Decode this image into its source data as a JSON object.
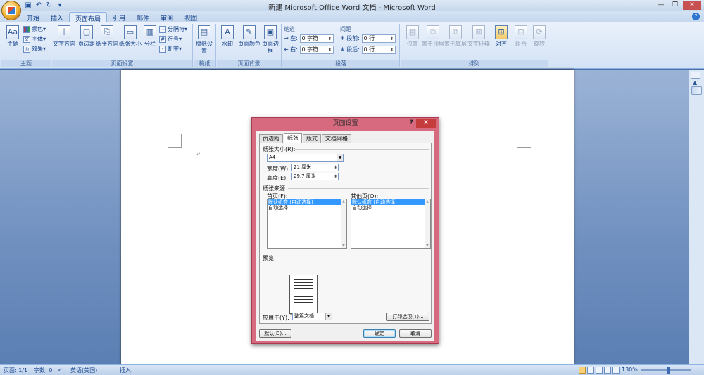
{
  "app": {
    "title": "新建 Microsoft Office Word 文档 - Microsoft Word",
    "qat_icons": [
      "save-icon",
      "undo-icon",
      "redo-icon",
      "customize-icon"
    ]
  },
  "tabs": [
    {
      "label": "开始",
      "active": false
    },
    {
      "label": "插入",
      "active": false
    },
    {
      "label": "页面布局",
      "active": true
    },
    {
      "label": "引用",
      "active": false
    },
    {
      "label": "邮件",
      "active": false
    },
    {
      "label": "审阅",
      "active": false
    },
    {
      "label": "视图",
      "active": false
    }
  ],
  "ribbon": {
    "theme": {
      "label": "主题",
      "theme_btn": "主题",
      "colors": "颜色",
      "fonts": "字体",
      "effects": "效果"
    },
    "page_setup": {
      "label": "页面设置",
      "text_direction": "文字方向",
      "margins": "页边距",
      "orientation": "纸张方向",
      "size": "纸张大小",
      "columns": "分栏",
      "breaks": "分隔符",
      "line_numbers": "行号",
      "hyphenation": "断字"
    },
    "draft": {
      "label": "稿纸",
      "btn": "稿纸设置"
    },
    "page_bg": {
      "label": "页面背景",
      "watermark": "水印",
      "page_color": "页面颜色",
      "page_borders": "页面边框"
    },
    "paragraph": {
      "label": "段落",
      "indent_head": "缩进",
      "spacing_head": "间距",
      "left_label": "左:",
      "left_value": "0 字符",
      "right_label": "右:",
      "right_value": "0 字符",
      "before_label": "段前:",
      "before_value": "0 行",
      "after_label": "段后:",
      "after_value": "0 行"
    },
    "arrange": {
      "label": "排列",
      "position": "位置",
      "bring_front": "置于顶层",
      "send_back": "置于底层",
      "wrap": "文字环绕",
      "align": "对齐",
      "group": "组合",
      "rotate": "旋转"
    }
  },
  "document": {
    "paragraph_mark": "↵"
  },
  "status": {
    "page": "页面: 1/1",
    "words": "字数: 0",
    "language": "英语(美国)",
    "mode": "插入",
    "zoom": "130%",
    "zoom_level": 0.55
  },
  "dialog": {
    "title": "页面设置",
    "help": "?",
    "tabs": [
      {
        "label": "页边距",
        "active": false
      },
      {
        "label": "纸张",
        "active": true
      },
      {
        "label": "版式",
        "active": false
      },
      {
        "label": "文档网格",
        "active": false
      }
    ],
    "paper_size_label": "纸张大小(R):",
    "paper_size_value": "A4",
    "width_label": "宽度(W):",
    "width_value": "21 厘米",
    "height_label": "高度(E):",
    "height_value": "29.7 厘米",
    "source_label": "纸张来源",
    "first_page_label": "首页(F):",
    "other_pages_label": "其他页(O):",
    "first_page_items": [
      "默认纸盒 (自动选择)",
      "自动选择"
    ],
    "other_pages_items": [
      "默认纸盒 (自动选择)",
      "自动选择"
    ],
    "preview_label": "预览",
    "apply_to_label": "应用于(Y):",
    "apply_to_value": "整篇文档",
    "print_options": "打印选项(T)...",
    "default_btn": "默认(D)...",
    "ok_btn": "确定",
    "cancel_btn": "取消"
  },
  "colors": {
    "dialog_frame": "#d86a7f",
    "ribbon": "#dfe9f5",
    "selection": "#3399ff"
  }
}
